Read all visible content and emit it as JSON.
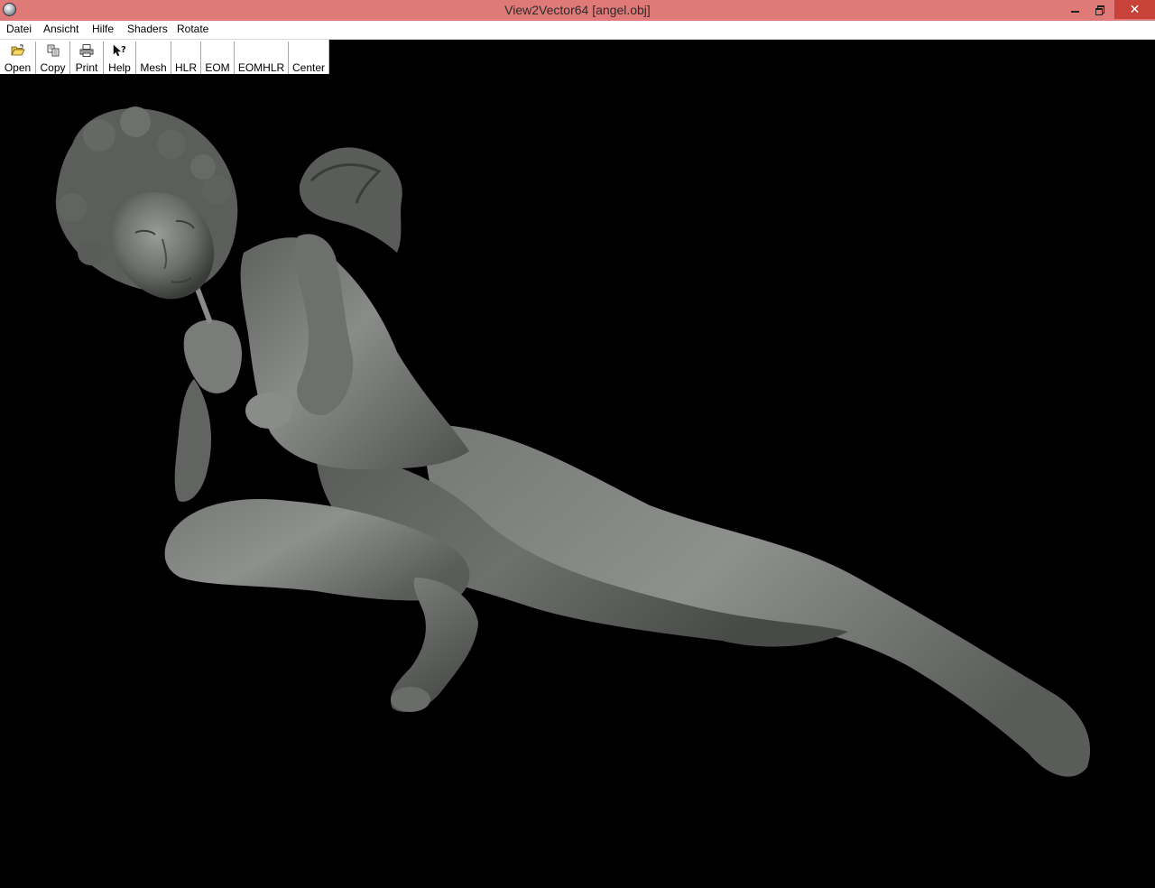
{
  "window": {
    "title": "View2Vector64 [angel.obj]"
  },
  "menu": {
    "items": [
      {
        "label": "Datei"
      },
      {
        "label": "Ansicht"
      },
      {
        "label": "Hilfe"
      },
      {
        "label": "Shaders"
      },
      {
        "label": "Rotate"
      }
    ]
  },
  "toolbar": {
    "buttons": [
      {
        "label": "Open",
        "icon": "folder-open-icon"
      },
      {
        "label": "Copy",
        "icon": "copy-icon"
      },
      {
        "label": "Print",
        "icon": "printer-icon"
      },
      {
        "label": "Help",
        "icon": "help-pointer-icon"
      },
      {
        "label": "Mesh",
        "icon": ""
      },
      {
        "label": "HLR",
        "icon": ""
      },
      {
        "label": "EOM",
        "icon": ""
      },
      {
        "label": "EOMHLR",
        "icon": ""
      },
      {
        "label": "Center",
        "icon": ""
      }
    ]
  },
  "viewport": {
    "background": "#000000",
    "model_color": "#6a6c6a"
  }
}
